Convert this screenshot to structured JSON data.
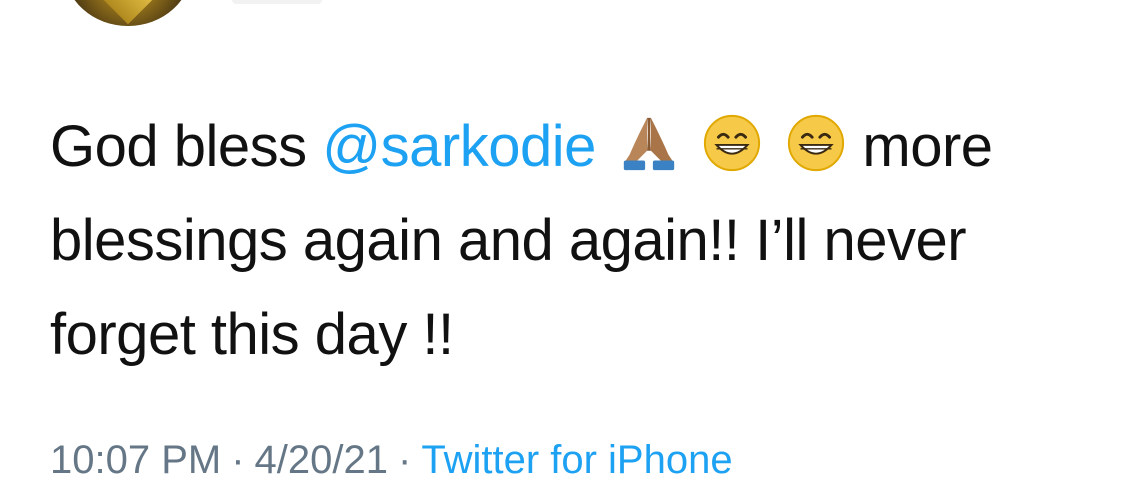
{
  "tweet": {
    "text_prefix": "God bless ",
    "mention": "@sarkodie",
    "text_after_emojis": "more",
    "line2": "blessings again and again!! I’ll never",
    "line3": "forget this day !!",
    "emojis": [
      "folded-hands-icon",
      "grinning-face-icon",
      "grinning-face-icon"
    ]
  },
  "meta": {
    "time": "10:07 PM",
    "separator": "·",
    "date": "4/20/21",
    "source": "Twitter for iPhone"
  },
  "colors": {
    "link": "#1da1f2",
    "text": "#111111",
    "meta": "#657786"
  }
}
